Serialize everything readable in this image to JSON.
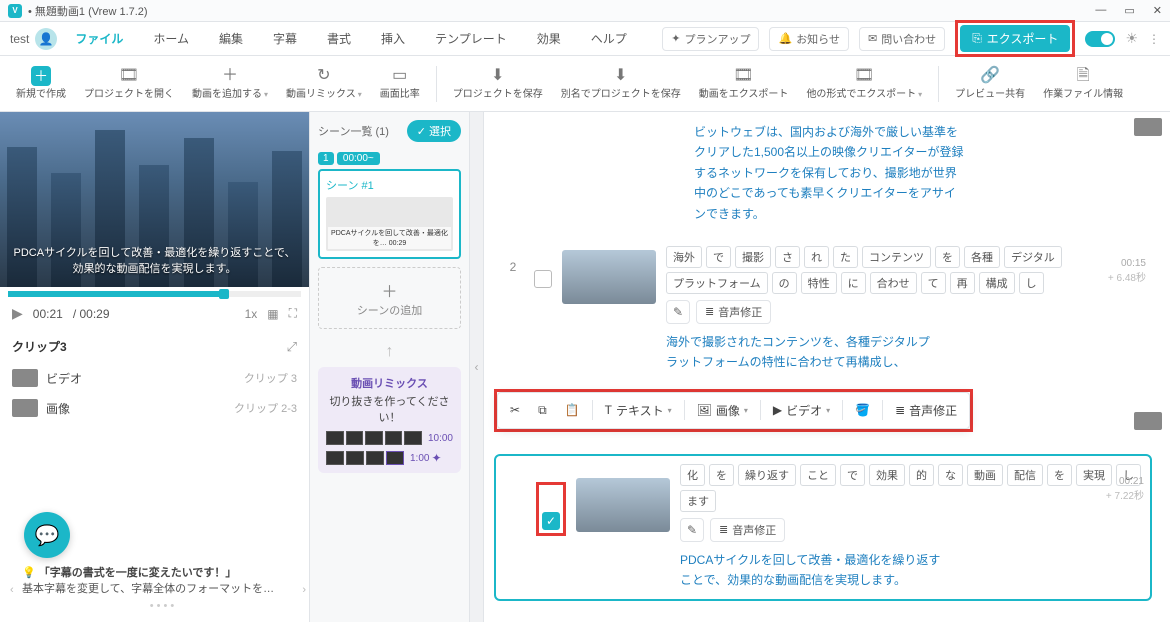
{
  "window": {
    "title": "• 無題動画1 (Vrew 1.7.2)",
    "app_badge": "V"
  },
  "menubar": {
    "user": "test",
    "items": [
      "ファイル",
      "ホーム",
      "編集",
      "字幕",
      "書式",
      "挿入",
      "テンプレート",
      "効果",
      "ヘルプ"
    ],
    "active_index": 0,
    "upgrade": "プランアップ",
    "notice": "お知らせ",
    "contact": "問い合わせ",
    "export": "エクスポート"
  },
  "toolbar": {
    "items": [
      {
        "label": "新規で作成",
        "primary": true,
        "icon": "＋"
      },
      {
        "label": "プロジェクトを開く",
        "icon": "🎞"
      },
      {
        "label": "動画を追加する",
        "icon": "＋",
        "chev": true
      },
      {
        "label": "動画リミックス",
        "icon": "↻",
        "chev": true
      },
      {
        "label": "画面比率",
        "icon": "▭"
      },
      {
        "label": "プロジェクトを保存",
        "icon": "⬇"
      },
      {
        "label": "別名でプロジェクトを保存",
        "icon": "⬇"
      },
      {
        "label": "動画をエクスポート",
        "icon": "🎞"
      },
      {
        "label": "他の形式でエクスポート",
        "icon": "🎞",
        "chev": true
      },
      {
        "label": "プレビュー共有",
        "icon": "🔗"
      },
      {
        "label": "作業ファイル情報",
        "icon": "🗎"
      }
    ],
    "separators_after": [
      4,
      8
    ]
  },
  "preview": {
    "caption": "PDCAサイクルを回して改善・最適化を繰り返すことで、効果的な動画配信を実現します。",
    "current": "00:21",
    "total": "/ 00:29",
    "speed": "1x"
  },
  "clips": {
    "title": "クリップ3",
    "rows": [
      {
        "name": "ビデオ",
        "tag": "クリップ 3"
      },
      {
        "name": "画像",
        "tag": "クリップ 2-3"
      }
    ]
  },
  "tips": {
    "title": "「字幕の書式を一度に変えたいです！」",
    "body": "基本字幕を変更して、字幕全体のフォーマットを…"
  },
  "scenes": {
    "header": "シーン一覧 (1)",
    "select": "選択",
    "badge": "1",
    "time": "00:00~",
    "card_label": "シーン #1",
    "thumb_caption": "PDCAサイクルを回して改善・最適化を… 00:29",
    "add": "シーンの追加",
    "remix_title": "動画リミックス",
    "remix_sub": "切り抜きを作ってください！",
    "strip1": "10:00",
    "strip2": "1:00"
  },
  "segments": {
    "desc1": "ビットウェブは、国内および海外で厳しい基準をクリアした1,500名以上の映像クリエイターが登録するネットワークを保有しており、撮影地が世界中のどこであっても素早くクリエイターをアサインできます。",
    "seg2": {
      "num": "2",
      "tokens": [
        "海外",
        "で",
        "撮影",
        "さ",
        "れ",
        "た",
        "コンテンツ",
        "を",
        "各種",
        "デジタル",
        "プラットフォーム",
        "の",
        "特性",
        "に",
        "合わせ",
        "て",
        "再",
        "構成",
        "し"
      ],
      "audio_fix": "音声修正",
      "time": "00:15",
      "dur": "+ 6.48秒",
      "desc": "海外で撮影されたコンテンツを、各種デジタルプラットフォームの特性に合わせて再構成し、"
    },
    "seg3": {
      "tokens": [
        "化",
        "を",
        "繰り返す",
        "こと",
        "で",
        "効果",
        "的",
        "な",
        "動画",
        "配信",
        "を",
        "実現",
        "し",
        "ます"
      ],
      "audio_fix": "音声修正",
      "time": "00:21",
      "dur": "+ 7.22秒",
      "desc": "PDCAサイクルを回して改善・最適化を繰り返すことで、効果的な動画配信を実現します。"
    }
  },
  "float_toolbar": {
    "text": "テキスト",
    "image": "画像",
    "video": "ビデオ",
    "audio_fix": "音声修正"
  }
}
